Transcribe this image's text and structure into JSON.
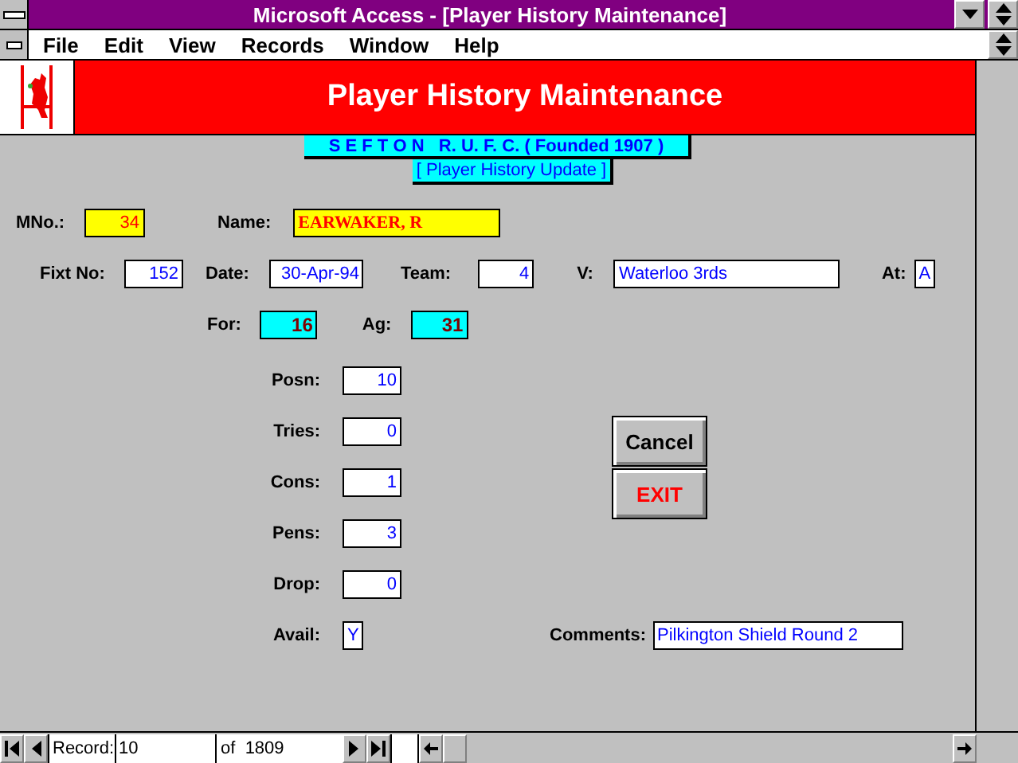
{
  "window": {
    "title": "Microsoft Access - [Player History Maintenance]"
  },
  "menu": [
    "File",
    "Edit",
    "View",
    "Records",
    "Window",
    "Help"
  ],
  "header": {
    "title": "Player History Maintenance"
  },
  "club_banner": "S E F T O N   R. U. F. C. ( Founded 1907 )",
  "subtitle": "[ Player History Update ]",
  "member_no": {
    "label": "MNo.:",
    "value": "34"
  },
  "name": {
    "label": "Name:",
    "value": "EARWAKER, R"
  },
  "fixture_no": {
    "label": "Fixt No:",
    "value": "152"
  },
  "date": {
    "label": "Date:",
    "value": "30-Apr-94"
  },
  "team": {
    "label": "Team:",
    "value": "4"
  },
  "versus": {
    "label": "V:",
    "value": "Waterloo 3rds"
  },
  "at": {
    "label": "At:",
    "value": "A"
  },
  "points_for": {
    "label": "For:",
    "value": "16"
  },
  "points_against": {
    "label": "Ag:",
    "value": "31"
  },
  "stats": [
    {
      "label": "Posn:",
      "value": "10"
    },
    {
      "label": "Tries:",
      "value": "0"
    },
    {
      "label": "Cons:",
      "value": "1"
    },
    {
      "label": "Pens:",
      "value": "3"
    },
    {
      "label": "Drop:",
      "value": "0"
    }
  ],
  "avail": {
    "label": "Avail:",
    "value": "Y"
  },
  "comments": {
    "label": "Comments:",
    "value": "Pilkington Shield Round 2"
  },
  "buttons": [
    {
      "label": "Cancel",
      "kind": "normal"
    },
    {
      "label": "EXIT",
      "kind": "danger"
    }
  ],
  "record_nav": {
    "label": "Record:",
    "value": "10",
    "total": "of  1809"
  }
}
